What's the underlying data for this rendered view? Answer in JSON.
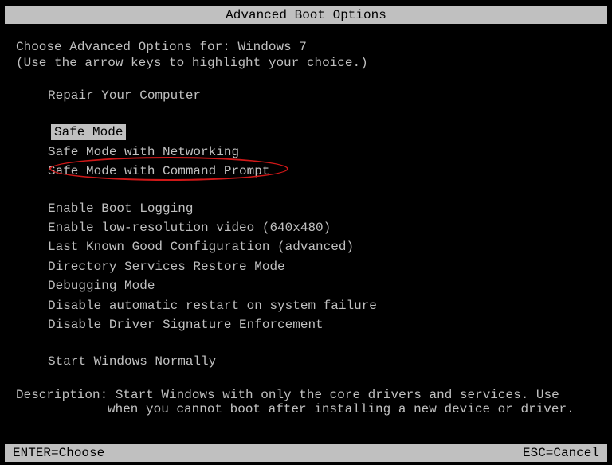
{
  "title": "Advanced Boot Options",
  "intro": {
    "line1": "Choose Advanced Options for: Windows 7",
    "line2": "(Use the arrow keys to highlight your choice.)"
  },
  "menu": {
    "groups": [
      [
        "Repair Your Computer"
      ],
      [
        "Safe Mode",
        "Safe Mode with Networking",
        "Safe Mode with Command Prompt"
      ],
      [
        "Enable Boot Logging",
        "Enable low-resolution video (640x480)",
        "Last Known Good Configuration (advanced)",
        "Directory Services Restore Mode",
        "Debugging Mode",
        "Disable automatic restart on system failure",
        "Disable Driver Signature Enforcement"
      ],
      [
        "Start Windows Normally"
      ]
    ],
    "selected": "Safe Mode",
    "circled": "Safe Mode with Command Prompt"
  },
  "description": {
    "label": "Description:",
    "line1": "Description: Start Windows with only the core drivers and services. Use",
    "line2": "when you cannot boot after installing a new device or driver."
  },
  "footer": {
    "left": "ENTER=Choose",
    "right": "ESC=Cancel"
  }
}
